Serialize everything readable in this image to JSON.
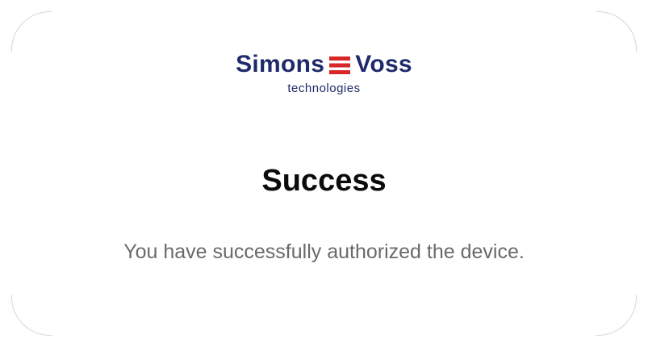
{
  "logo": {
    "brand_left": "Simons",
    "brand_right": "Voss",
    "tagline": "technologies",
    "brand_color": "#1e2a6b",
    "mark_color": "#d62828",
    "icon": "simonsvoss-logo-mark-icon"
  },
  "dialog": {
    "title": "Success",
    "message": "You have successfully authorized the device."
  },
  "colors": {
    "title": "#0b0b0b",
    "message": "#6a6a6a",
    "background": "#ffffff",
    "border": "#d8d8d8"
  }
}
